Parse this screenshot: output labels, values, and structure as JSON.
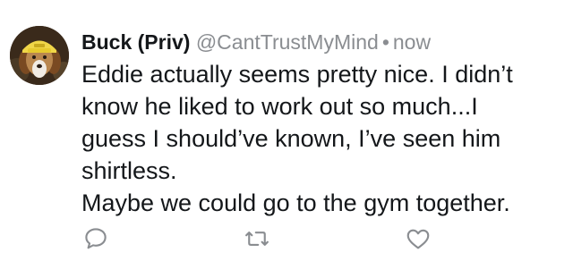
{
  "tweet": {
    "display_name": "Buck (Priv)",
    "handle": "@CantTrustMyMind",
    "separator": "•",
    "time": "now",
    "text_lines": [
      "Eddie actually seems pretty nice. I didn’t",
      "know he liked to work out so much...I",
      "guess I should’ve known, I’ve seen him",
      "shirtless.",
      "Maybe we could go to the gym together."
    ]
  },
  "actions": {
    "reply_icon": "reply-icon",
    "retweet_icon": "retweet-icon",
    "like_icon": "heart-icon"
  },
  "colors": {
    "text": "#14171a",
    "secondary": "#8a8d91",
    "icon": "#8a8d91",
    "background": "#ffffff"
  }
}
